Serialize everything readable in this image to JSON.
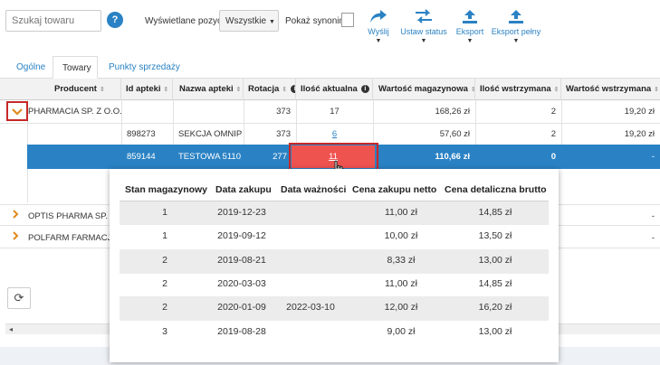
{
  "toolbar": {
    "search_placeholder": "Szukaj towaru",
    "help_glyph": "?",
    "display_label": "Wyświetlane pozycje",
    "display_value": "Wszystkie",
    "synonyms_label": "Pokaż synonimy",
    "buttons": [
      {
        "label": "Wyślij",
        "icon": "share-icon"
      },
      {
        "label": "Ustaw status",
        "icon": "swap-arrows-icon"
      },
      {
        "label": "Eksport",
        "icon": "upload-icon"
      },
      {
        "label": "Eksport pełny",
        "icon": "upload-icon"
      }
    ],
    "accent_color": "#2a82c4"
  },
  "tabs": [
    {
      "label": "Ogólne",
      "active": false
    },
    {
      "label": "Towary",
      "active": true
    },
    {
      "label": "Punkty sprzedaży",
      "active": false
    }
  ],
  "grid": {
    "columns": [
      "Producent",
      "Id apteki",
      "Nazwa apteki",
      "Rotacja",
      "Ilość aktualna",
      "Wartość magazynowa",
      "Ilość wstrzymana",
      "Wartość wstrzymana"
    ],
    "group_rows": [
      {
        "producer": "PHARMACIA SP. Z O.O.",
        "rotation": "373",
        "qty": "17",
        "value": "168,26 zł",
        "held_qty": "2",
        "held_value": "19,20 zł",
        "expanded": true
      },
      {
        "producer": "OPTIS PHARMA SP. Z O.O.",
        "held_value": "-",
        "expanded": false
      },
      {
        "producer": "POLFARM FARMACJA POL...",
        "held_value": "-",
        "expanded": false
      }
    ],
    "detail_rows": [
      {
        "id": "898273",
        "name": "SEKCJA OMNIP...",
        "rotation": "373",
        "qty": "6",
        "value": "57,60 zł",
        "held_qty": "2",
        "held_value": "19,20 zł"
      },
      {
        "id": "859144",
        "name": "TESTOWA 5110...",
        "rotation": "277",
        "qty": "11",
        "value": "110,66 zł",
        "held_qty": "0",
        "held_value": "-"
      }
    ],
    "selected_color": "#2a82c4",
    "highlight_color": "#ef5350"
  },
  "popup": {
    "columns": [
      "Stan magazynowy",
      "Data zakupu",
      "Data ważności",
      "Cena zakupu netto",
      "Cena detaliczna brutto"
    ],
    "rows": [
      [
        "1",
        "2019-12-23",
        "",
        "11,00 zł",
        "14,85 zł"
      ],
      [
        "1",
        "2019-09-12",
        "",
        "10,00 zł",
        "13,50 zł"
      ],
      [
        "2",
        "2019-08-21",
        "",
        "8,33 zł",
        "13,00 zł"
      ],
      [
        "2",
        "2020-03-03",
        "",
        "11,00 zł",
        "14,85 zł"
      ],
      [
        "2",
        "2020-01-09",
        "2022-03-10",
        "12,00 zł",
        "16,20 zł"
      ],
      [
        "3",
        "2019-08-28",
        "",
        "9,00 zł",
        "13,00 zł"
      ]
    ]
  },
  "refresh_icon": "refresh-icon"
}
